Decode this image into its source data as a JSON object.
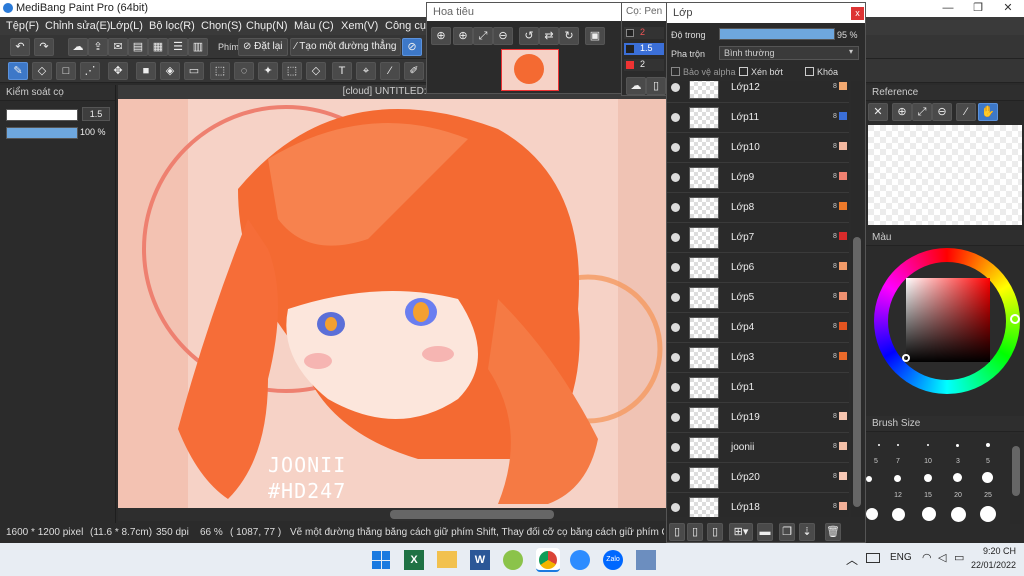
{
  "app": {
    "title": "MediBang Paint Pro (64bit)"
  },
  "window_controls": {
    "minimize": "—",
    "maximize": "❐",
    "close": "✕"
  },
  "menu": [
    "Tệp(F)",
    "Chỉnh sửa(E)",
    "Lớp(L)",
    "Bộ lọc(R)",
    "Chọn(S)",
    "Chụp(N)",
    "Màu (C)",
    "Xem(V)",
    "Công cụ"
  ],
  "toolbar": {
    "brush_label": "Phím",
    "reset_label": "Đặt lại",
    "line_label": "Tạo một đường thẳng"
  },
  "brush_control": {
    "title": "Kiểm soát cọ",
    "size_value": "1.5",
    "opacity_value": "100 %",
    "size_level": 0.9,
    "opacity_level": 1.0
  },
  "canvas": {
    "title": "[cloud] UNTITLED:r1+",
    "watermark_line1": "JOONII",
    "watermark_line2": "#HD247"
  },
  "navigator": {
    "title": "Hoa tiêu"
  },
  "color_mini": {
    "title": "Cọ: Pen",
    "rows": [
      "2",
      "1.5",
      "2"
    ]
  },
  "layers_panel": {
    "title": "Lớp",
    "opacity_label": "Độ trong",
    "opacity_value": "95 %",
    "opacity_level": 0.95,
    "blend_label": "Pha trộn",
    "blend_value": "Bình thường",
    "protect_alpha": "Bảo vệ alpha",
    "clip": "Xén bớt",
    "lock": "Khóa",
    "layers": [
      {
        "name": "Lớp12",
        "num": "8",
        "color": "#f2a870"
      },
      {
        "name": "Lớp11",
        "num": "8",
        "color": "#3b6fd8"
      },
      {
        "name": "Lớp10",
        "num": "8",
        "color": "#f4b8a0"
      },
      {
        "name": "Lớp9",
        "num": "8",
        "color": "#f08070"
      },
      {
        "name": "Lớp8",
        "num": "8",
        "color": "#ee7a2a"
      },
      {
        "name": "Lớp7",
        "num": "8",
        "color": "#d82b2b"
      },
      {
        "name": "Lớp6",
        "num": "8",
        "color": "#f29a68"
      },
      {
        "name": "Lớp5",
        "num": "8",
        "color": "#ef9070"
      },
      {
        "name": "Lớp4",
        "num": "8",
        "color": "#e35420"
      },
      {
        "name": "Lớp3",
        "num": "8",
        "color": "#ea6a2a"
      },
      {
        "name": "Lớp1",
        "num": "",
        "color": ""
      },
      {
        "name": "Lớp19",
        "num": "8",
        "color": "#f6c4ae"
      },
      {
        "name": "joonii",
        "num": "8",
        "color": "#f4c0a8"
      },
      {
        "name": "Lớp20",
        "num": "8",
        "color": "#f7c8b5"
      },
      {
        "name": "Lớp18",
        "num": "8",
        "color": "#f2b098"
      }
    ]
  },
  "reference": {
    "title": "Reference"
  },
  "color_panel": {
    "title": "Màu"
  },
  "brush_size": {
    "title": "Brush Size",
    "labels": [
      "5",
      "7",
      "10",
      "3",
      "5",
      "12",
      "15",
      "20",
      "25"
    ]
  },
  "status": {
    "pixels": "1600 * 1200 pixel",
    "cm": "(11.6 * 8.7cm)",
    "dpi": "350 dpi",
    "zoom": "66 %",
    "coords": "( 1087, 77 )",
    "hint": "Vẽ một đường thẳng bằng cách giữ phím Shift, Thay đổi cỡ cọ bằng cách giữ phím Ctr"
  },
  "taskbar": {
    "lang": "ENG",
    "time": "9:20 CH",
    "date": "22/01/2022"
  }
}
